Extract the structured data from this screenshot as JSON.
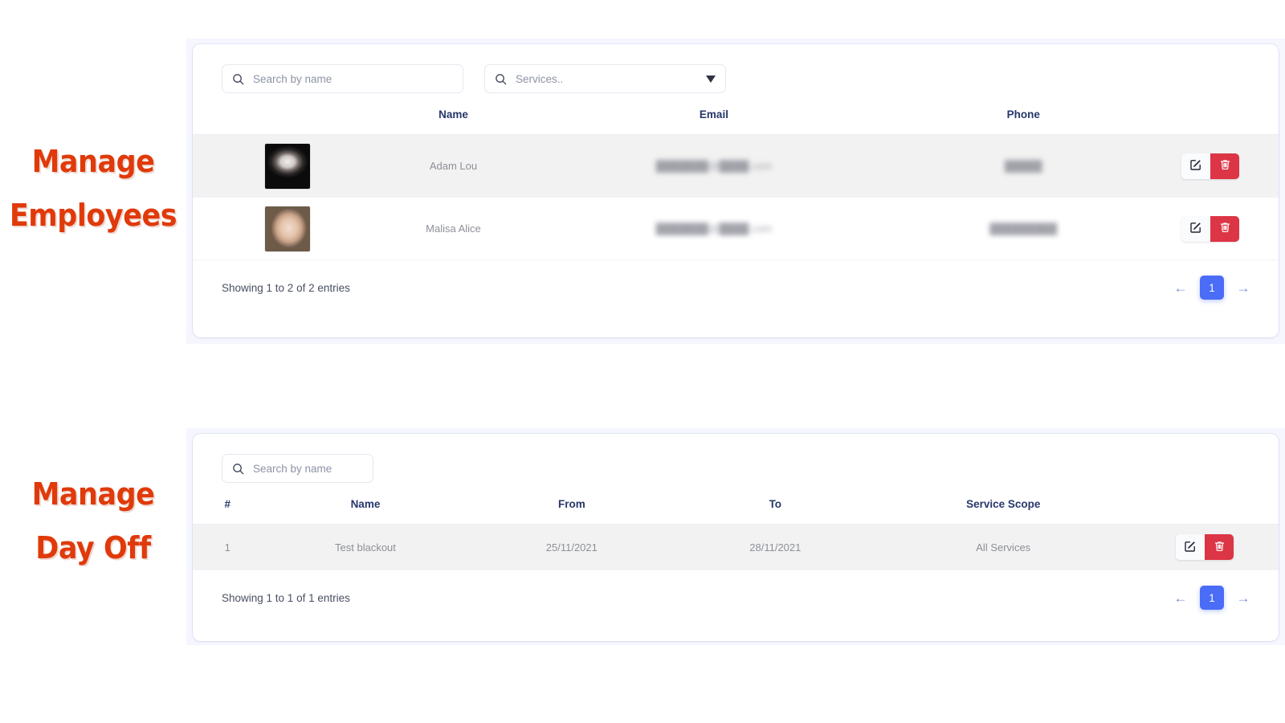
{
  "annotations": {
    "employees": {
      "line1": "Manage",
      "line2": "Employees",
      "color": "#e03a0a"
    },
    "dayoff": {
      "line1": "Manage",
      "line2": "Day Off",
      "color": "#e03a0a"
    }
  },
  "theme": {
    "page_bg": "#ffffff",
    "strip_bg": "#f5f6fe",
    "panel_bg": "#ffffff",
    "header_text": "#27376b",
    "body_text": "#8d8f98",
    "row_stripe": "#f2f2f2",
    "primary": "#4a6cf7",
    "danger": "#dc3545"
  },
  "employees_panel": {
    "search": {
      "name_placeholder": "Search by name",
      "name_value": "",
      "icon": "search-icon"
    },
    "service_filter": {
      "placeholder": "Services..",
      "value": "",
      "icon": "search-icon",
      "caret": "caret-down-icon"
    },
    "table": {
      "columns": [
        "",
        "Name",
        "Email",
        "Phone",
        ""
      ],
      "rows": [
        {
          "avatar": "male-portrait-avatar",
          "name": "Adam Lou",
          "email": "███████@████.com",
          "email_redacted": true,
          "phone": "█████",
          "phone_redacted": true,
          "striped": true,
          "edit_label": "edit-icon",
          "delete_label": "trash-icon"
        },
        {
          "avatar": "female-portrait-avatar",
          "name": "Malisa Alice",
          "email": "███████@████.com",
          "email_redacted": true,
          "phone": "█████████",
          "phone_redacted": true,
          "striped": false,
          "edit_label": "edit-icon",
          "delete_label": "trash-icon"
        }
      ]
    },
    "footer": {
      "entries": "Showing 1 to 2 of 2 entries",
      "prev": "←",
      "page": "1",
      "next": "→"
    }
  },
  "dayoff_panel": {
    "search": {
      "name_placeholder": "Search by name",
      "name_value": "",
      "icon": "search-icon"
    },
    "table": {
      "columns": [
        "#",
        "Name",
        "From",
        "To",
        "Service Scope",
        ""
      ],
      "rows": [
        {
          "num": "1",
          "name": "Test blackout",
          "from": "25/11/2021",
          "to": "28/11/2021",
          "scope": "All Services",
          "striped": true,
          "edit_label": "edit-icon",
          "delete_label": "trash-icon"
        }
      ]
    },
    "footer": {
      "entries": "Showing 1 to 1 of 1 entries",
      "prev": "←",
      "page": "1",
      "next": "→"
    }
  }
}
